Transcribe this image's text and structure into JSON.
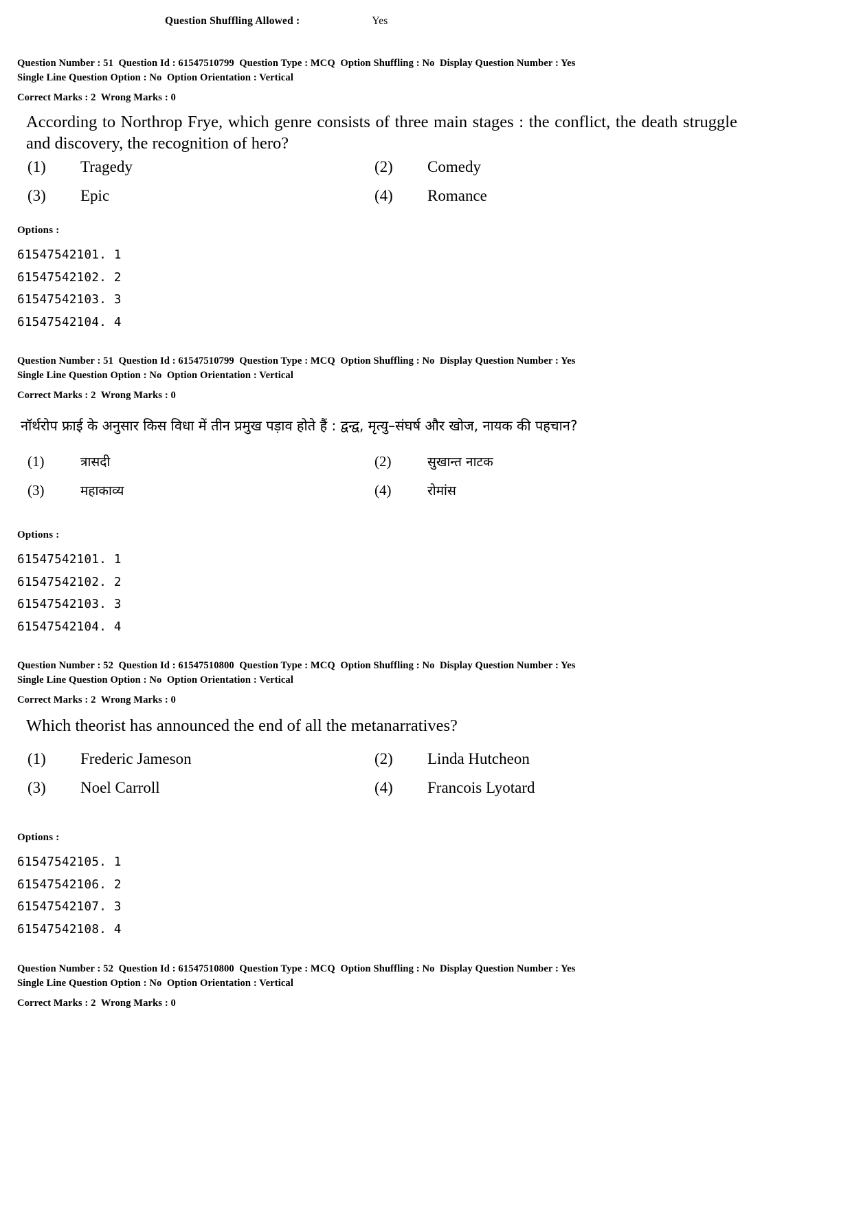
{
  "header": {
    "shuffle_label": "Question Shuffling Allowed :",
    "shuffle_value": "Yes"
  },
  "blocks": {
    "q51_en_meta": {
      "line1": "Question Number : 51  Question Id : 61547510799  Question Type : MCQ  Option Shuffling : No  Display Question Number : Yes",
      "line2": "Single Line Question Option : No  Option Orientation : Vertical",
      "marks": "Correct Marks : 2  Wrong Marks : 0"
    },
    "q51_hi_meta": {
      "line1": "Question Number : 51  Question Id : 61547510799  Question Type : MCQ  Option Shuffling : No  Display Question Number : Yes",
      "line2": "Single Line Question Option : No  Option Orientation : Vertical",
      "marks": "Correct Marks : 2  Wrong Marks : 0"
    },
    "q52_en_meta": {
      "line1": "Question Number : 52  Question Id : 61547510800  Question Type : MCQ  Option Shuffling : No  Display Question Number : Yes",
      "line2": "Single Line Question Option : No  Option Orientation : Vertical",
      "marks": "Correct Marks : 2  Wrong Marks : 0"
    },
    "q52_hi_meta": {
      "line1": "Question Number : 52  Question Id : 61547510800  Question Type : MCQ  Option Shuffling : No  Display Question Number : Yes",
      "line2": "Single Line Question Option : No  Option Orientation : Vertical",
      "marks": "Correct Marks : 2  Wrong Marks : 0"
    }
  },
  "q51_en": {
    "stem": "According to Northrop Frye, which genre consists of three main stages : the conflict, the death struggle and discovery, the recognition of hero?",
    "choices": [
      {
        "num": "(1)",
        "text": "Tragedy"
      },
      {
        "num": "(2)",
        "text": "Comedy"
      },
      {
        "num": "(3)",
        "text": "Epic"
      },
      {
        "num": "(4)",
        "text": "Romance"
      }
    ],
    "options_title": "Options :",
    "option_ids": [
      "61547542101. 1",
      "61547542102. 2",
      "61547542103. 3",
      "61547542104. 4"
    ]
  },
  "q51_hi": {
    "stem": "नॉर्थरोप फ्राई के अनुसार किस विधा में तीन प्रमुख पड़ाव होते हैं : द्वन्द्व, मृत्यु–संघर्ष और खोज, नायक की पहचान?",
    "choices": [
      {
        "num": "(1)",
        "text": "त्रासदी"
      },
      {
        "num": "(2)",
        "text": "सुखान्त नाटक"
      },
      {
        "num": "(3)",
        "text": "महाकाव्य"
      },
      {
        "num": "(4)",
        "text": "रोमांस"
      }
    ],
    "options_title": "Options :",
    "option_ids": [
      "61547542101. 1",
      "61547542102. 2",
      "61547542103. 3",
      "61547542104. 4"
    ]
  },
  "q52_en": {
    "stem": "Which theorist has announced the end of all the metanarratives?",
    "choices": [
      {
        "num": "(1)",
        "text": "Frederic Jameson"
      },
      {
        "num": "(2)",
        "text": "Linda Hutcheon"
      },
      {
        "num": "(3)",
        "text": "Noel Carroll"
      },
      {
        "num": "(4)",
        "text": "Francois Lyotard"
      }
    ],
    "options_title": "Options :",
    "option_ids": [
      "61547542105. 1",
      "61547542106. 2",
      "61547542107. 3",
      "61547542108. 4"
    ]
  }
}
